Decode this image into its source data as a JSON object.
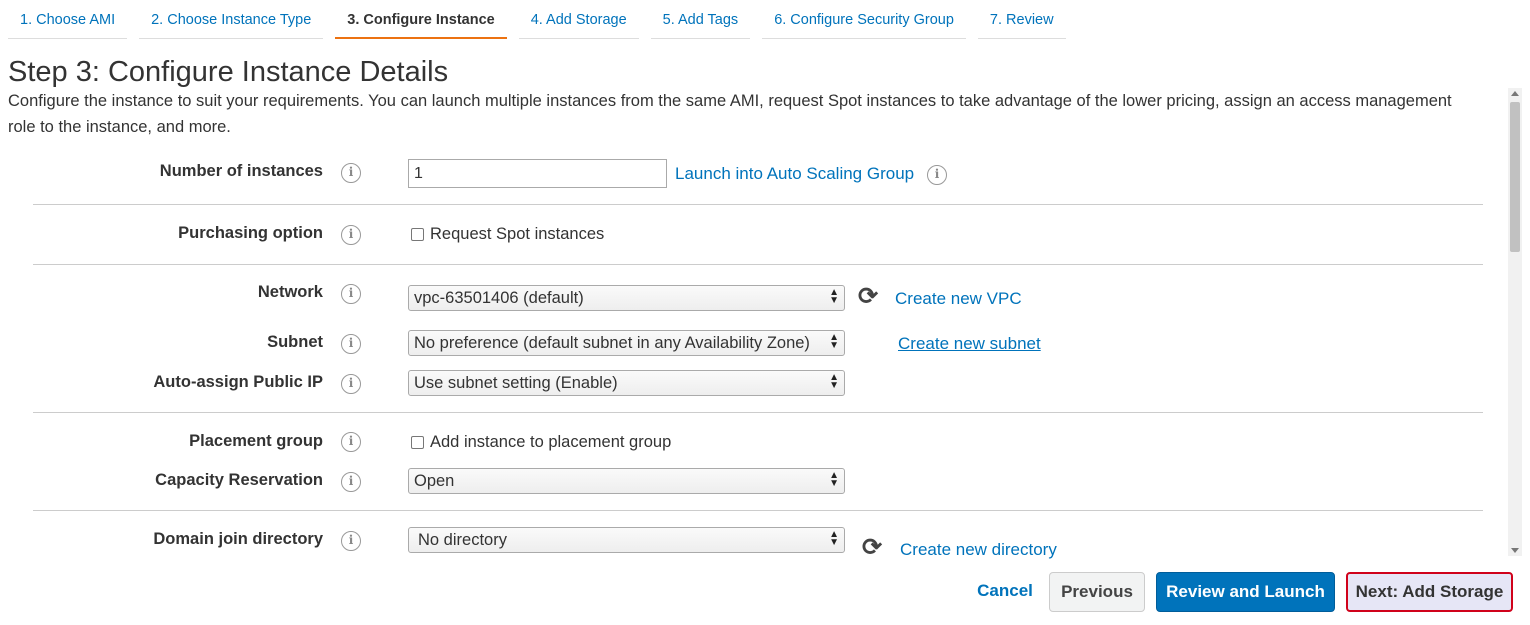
{
  "tabs": [
    {
      "label": "1. Choose AMI"
    },
    {
      "label": "2. Choose Instance Type"
    },
    {
      "label": "3. Configure Instance"
    },
    {
      "label": "4. Add Storage"
    },
    {
      "label": "5. Add Tags"
    },
    {
      "label": "6. Configure Security Group"
    },
    {
      "label": "7. Review"
    }
  ],
  "page": {
    "title": "Step 3: Configure Instance Details",
    "description": "Configure the instance to suit your requirements. You can launch multiple instances from the same AMI, request Spot instances to take advantage of the lower pricing, assign an access management role to the instance, and more."
  },
  "form": {
    "num_instances": {
      "label": "Number of instances",
      "value": "1",
      "link": "Launch into Auto Scaling Group"
    },
    "purchasing": {
      "label": "Purchasing option",
      "checkbox": "Request Spot instances",
      "checked": false
    },
    "network": {
      "label": "Network",
      "value": "vpc-63501406 (default)",
      "link": "Create new VPC"
    },
    "subnet": {
      "label": "Subnet",
      "value": "No preference (default subnet in any Availability Zone)",
      "link": "Create new subnet"
    },
    "public_ip": {
      "label": "Auto-assign Public IP",
      "value": "Use subnet setting (Enable)"
    },
    "placement": {
      "label": "Placement group",
      "checkbox": "Add instance to placement group",
      "checked": false
    },
    "capacity": {
      "label": "Capacity Reservation",
      "value": "Open"
    },
    "domain": {
      "label": "Domain join directory",
      "value": "No directory",
      "link": "Create new directory"
    }
  },
  "icons": {
    "info": "info-icon",
    "refresh": "refresh-icon"
  },
  "footer": {
    "cancel": "Cancel",
    "previous": "Previous",
    "review": "Review and Launch",
    "next": "Next: Add Storage"
  },
  "colors": {
    "link": "#0073bb",
    "primary": "#0073bb",
    "active_tab": "#ec7211",
    "highlight": "#d0021b"
  }
}
